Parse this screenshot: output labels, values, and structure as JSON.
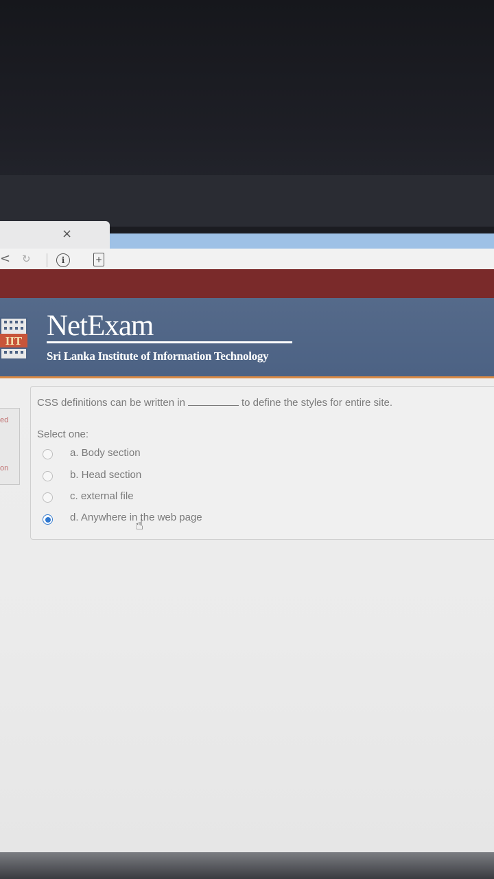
{
  "browser": {
    "close_glyph": "×",
    "back_glyph": "<",
    "reload_glyph": "↻",
    "info_glyph": "i",
    "ext_glyph": "+"
  },
  "header": {
    "title": "NetExam",
    "subtitle": "Sri Lanka Institute of Information Technology",
    "logo_text": "IIT"
  },
  "sidebar": {
    "fragment_1": "ed",
    "fragment_2": "on"
  },
  "question": {
    "text_before": "CSS definitions can be written in",
    "text_after": "to define the styles for entire site.",
    "select_prompt": "Select one:",
    "options": [
      {
        "label": "a. Body section",
        "selected": false
      },
      {
        "label": "b. Head section",
        "selected": false
      },
      {
        "label": "c. external file",
        "selected": false
      },
      {
        "label": "d. Anywhere in the web page",
        "selected": true
      }
    ]
  },
  "colors": {
    "header_blue": "#4c6284",
    "header_red": "#7a2a2a",
    "accent_orange": "#d98a45",
    "radio_selected": "#2f78d0"
  }
}
